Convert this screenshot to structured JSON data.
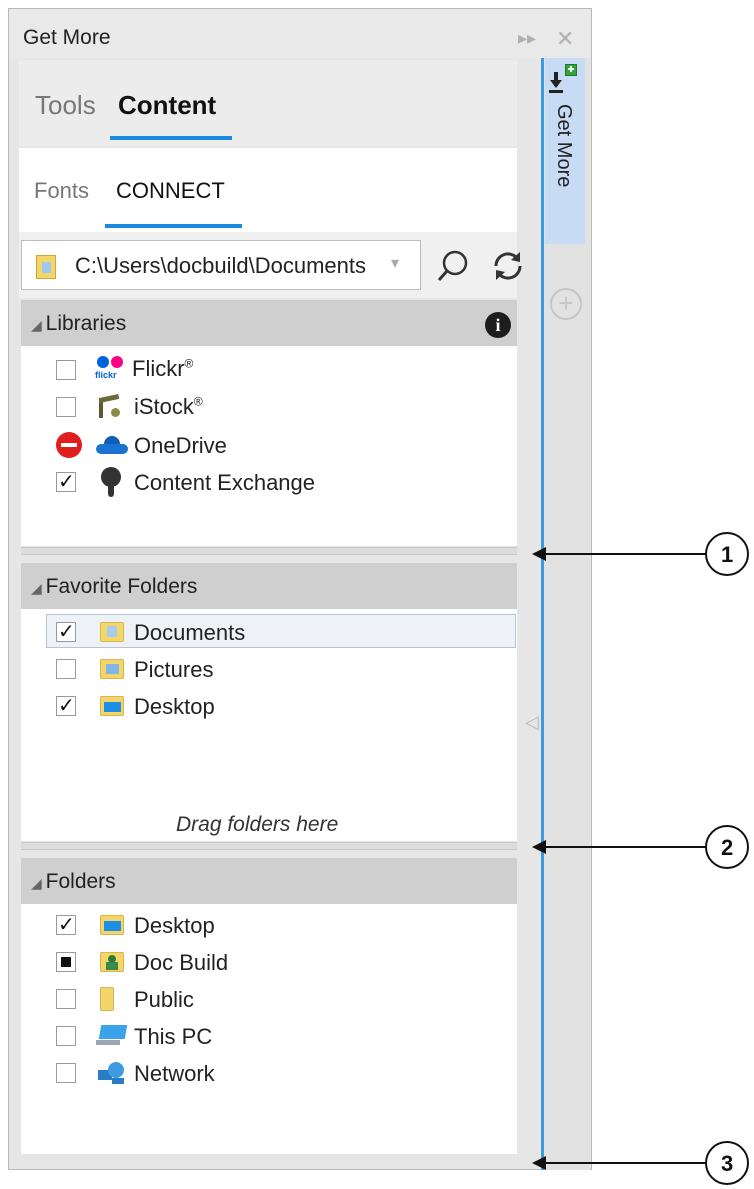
{
  "window": {
    "title": "Get More",
    "pin_icon": "pin-icon",
    "close_icon": "close-icon"
  },
  "tabs_primary": [
    {
      "label": "Tools",
      "active": false
    },
    {
      "label": "Content",
      "active": true
    }
  ],
  "tabs_secondary": [
    {
      "label": "Fonts",
      "active": false
    },
    {
      "label": "CONNECT",
      "active": true
    }
  ],
  "path_bar": {
    "value": "C:\\Users\\docbuild\\Documents",
    "search_icon": "search-icon",
    "refresh_icon": "refresh-icon"
  },
  "libraries": {
    "title": "Libraries",
    "info_icon": "info-icon",
    "items": [
      {
        "label": "Flickr",
        "mark": "®",
        "state": "unchecked",
        "icon": "flickr-icon"
      },
      {
        "label": "iStock",
        "mark": "®",
        "state": "unchecked",
        "icon": "istock-icon"
      },
      {
        "label": "OneDrive",
        "state": "blocked",
        "icon": "onedrive-icon"
      },
      {
        "label": "Content Exchange",
        "state": "checked",
        "icon": "content-exchange-icon"
      }
    ]
  },
  "favorite_folders": {
    "title": "Favorite Folders",
    "items": [
      {
        "label": "Documents",
        "state": "checked",
        "selected": true
      },
      {
        "label": "Pictures",
        "state": "unchecked"
      },
      {
        "label": "Desktop",
        "state": "checked"
      }
    ],
    "drop_hint": "Drag folders here"
  },
  "folders": {
    "title": "Folders",
    "items": [
      {
        "label": "Desktop",
        "state": "checked"
      },
      {
        "label": "Doc Build",
        "state": "mixed"
      },
      {
        "label": "Public",
        "state": "unchecked"
      },
      {
        "label": "This PC",
        "state": "unchecked"
      },
      {
        "label": "Network",
        "state": "unchecked"
      }
    ]
  },
  "side_tab": {
    "label": "Get More",
    "add_icon": "add-icon"
  },
  "callouts": [
    "1",
    "2",
    "3"
  ],
  "colors": {
    "accent": "#1a8ae0",
    "header": "#cfcfcf",
    "side_tab": "#c8dbf4"
  }
}
